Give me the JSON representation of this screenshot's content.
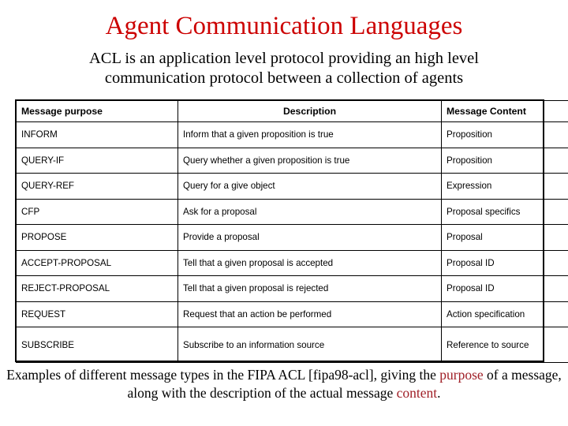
{
  "slide": {
    "title": "Agent Communication Languages",
    "subtitle_line1": "ACL is an application level protocol providing an high level",
    "subtitle_line2": "communication protocol between a collection of agents",
    "title_color": "#cc0000",
    "highlight_color": "#a02028",
    "text_color": "#000000",
    "background_color": "#ffffff"
  },
  "table": {
    "headers": {
      "purpose": "Message purpose",
      "description": "Description",
      "content": "Message Content"
    },
    "rows": [
      {
        "purpose": "INFORM",
        "description": "Inform that a given proposition is true",
        "content": "Proposition"
      },
      {
        "purpose": "QUERY-IF",
        "description": "Query whether a given proposition is true",
        "content": "Proposition"
      },
      {
        "purpose": "QUERY-REF",
        "description": "Query for a give object",
        "content": "Expression"
      },
      {
        "purpose": "CFP",
        "description": "Ask for a proposal",
        "content": "Proposal specifics"
      },
      {
        "purpose": "PROPOSE",
        "description": "Provide a proposal",
        "content": "Proposal"
      },
      {
        "purpose": "ACCEPT-PROPOSAL",
        "description": "Tell that a given proposal is accepted",
        "content": "Proposal ID"
      },
      {
        "purpose": "REJECT-PROPOSAL",
        "description": "Tell that a given proposal is rejected",
        "content": "Proposal ID"
      },
      {
        "purpose": "REQUEST",
        "description": "Request that an action be performed",
        "content": "Action specification"
      },
      {
        "purpose": "SUBSCRIBE",
        "description": "Subscribe to an information source",
        "content": "Reference to source"
      }
    ]
  },
  "footer": {
    "part1": "Examples of different message types in the FIPA ACL [fipa98-acl], giving the ",
    "highlight1": "purpose",
    "part2": " of a message, along with the description of the actual message ",
    "highlight2": "content",
    "part3": "."
  }
}
